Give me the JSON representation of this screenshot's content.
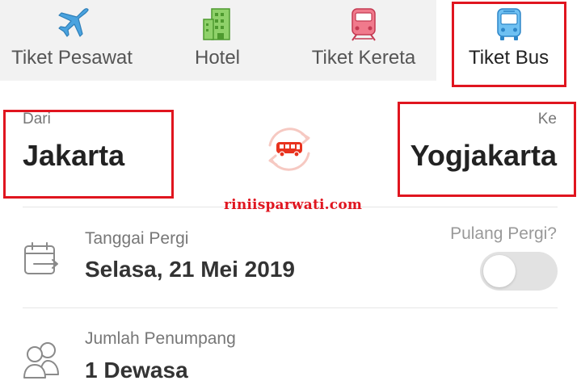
{
  "tabs": [
    {
      "label": "Tiket Pesawat",
      "icon": "airplane-icon",
      "color": "#4aa3df"
    },
    {
      "label": "Hotel",
      "icon": "hotel-building-icon",
      "color": "#6ab04c"
    },
    {
      "label": "Tiket Kereta",
      "icon": "train-icon",
      "color": "#e0455f"
    },
    {
      "label": "Tiket Bus",
      "icon": "bus-icon",
      "color": "#3a9be0",
      "selected": true
    }
  ],
  "route": {
    "from_label": "Dari",
    "from_city": "Jakarta",
    "to_label": "Ke",
    "to_city": "Yogjakarta",
    "swap_icon": "swap-bus-icon"
  },
  "watermark": "riniisparwati.com",
  "date": {
    "label": "Tanggai Pergi",
    "value": "Selasa, 21 Mei 2019",
    "icon": "calendar-icon"
  },
  "round_trip": {
    "label": "Pulang Pergi?",
    "enabled": false
  },
  "passengers": {
    "label": "Jumlah Penumpang",
    "value": "1 Dewasa",
    "icon": "passengers-icon"
  },
  "colors": {
    "highlight": "#e0151f",
    "accent": "#e8321e",
    "tab_bg": "#f2f2f2"
  }
}
